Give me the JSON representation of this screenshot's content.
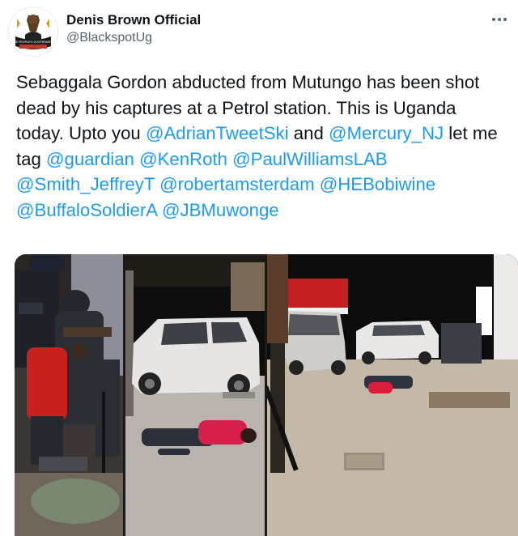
{
  "author": {
    "name": "Denis Brown Official",
    "handle": "@BlackspotUg",
    "avatar_caption": "THE PEOPLE'S GOVERNMENT"
  },
  "tweet": {
    "segments": [
      {
        "text": "Sebaggala Gordon abducted from Mutungo has been shot dead by his captures at a Petrol station. This is Uganda today. Upto you ",
        "type": "text"
      },
      {
        "text": "@AdrianTweetSki",
        "type": "mention"
      },
      {
        "text": " and ",
        "type": "text"
      },
      {
        "text": "@Mercury_NJ",
        "type": "mention"
      },
      {
        "text": " let me tag ",
        "type": "text"
      },
      {
        "text": "@guardian",
        "type": "mention"
      },
      {
        "text": "  ",
        "type": "text"
      },
      {
        "text": "@KenRoth",
        "type": "mention"
      },
      {
        "text": " ",
        "type": "text"
      },
      {
        "text": "@PaulWilliamsLAB",
        "type": "mention"
      },
      {
        "text": " ",
        "type": "text"
      },
      {
        "text": "@Smith_JeffreyT",
        "type": "mention"
      },
      {
        "text": " ",
        "type": "text"
      },
      {
        "text": "@robertamsterdam",
        "type": "mention"
      },
      {
        "text": " ",
        "type": "text"
      },
      {
        "text": "@HEBobiwine",
        "type": "mention"
      },
      {
        "text": " ",
        "type": "text"
      },
      {
        "text": "@BuffaloSoldierA",
        "type": "mention"
      },
      {
        "text": " ",
        "type": "text"
      },
      {
        "text": "@JBMuwonge",
        "type": "mention"
      }
    ]
  },
  "media": {
    "photos": [
      "photo-arrest",
      "photo-victim-by-car",
      "photo-petrol-station"
    ]
  },
  "colors": {
    "mention": "#1d9bf0",
    "text": "#0f1419",
    "secondary": "#536471"
  },
  "icons": {
    "more": "more-icon"
  }
}
